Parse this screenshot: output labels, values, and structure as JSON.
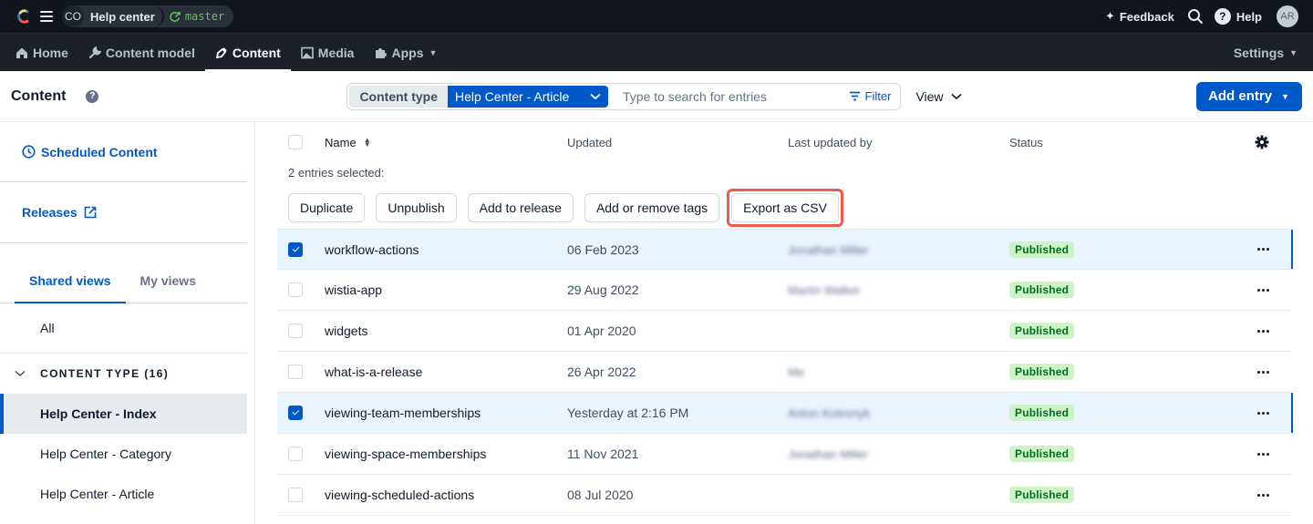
{
  "topbar": {
    "space_initials": "CO",
    "space_name": "Help center",
    "environment": "master",
    "feedback_label": "Feedback",
    "help_label": "Help",
    "avatar_initials": "AR"
  },
  "nav": {
    "items": [
      {
        "label": "Home",
        "icon": "home-icon",
        "active": false
      },
      {
        "label": "Content model",
        "icon": "wrench-icon",
        "active": false
      },
      {
        "label": "Content",
        "icon": "pen-icon",
        "active": true
      },
      {
        "label": "Media",
        "icon": "image-icon",
        "active": false
      },
      {
        "label": "Apps",
        "icon": "puzzle-icon",
        "active": false,
        "has_dropdown": true
      }
    ],
    "settings_label": "Settings"
  },
  "toolbar": {
    "title": "Content",
    "content_type_label": "Content type",
    "content_type_value": "Help Center - Article",
    "search_placeholder": "Type to search for entries",
    "search_value": "",
    "filter_label": "Filter",
    "view_label": "View",
    "add_entry_label": "Add entry"
  },
  "sidebar": {
    "scheduled_label": "Scheduled Content",
    "releases_label": "Releases",
    "tabs": [
      {
        "label": "Shared views",
        "active": true
      },
      {
        "label": "My views",
        "active": false
      }
    ],
    "all_label": "All",
    "content_type_header": "CONTENT TYPE (16)",
    "items": [
      {
        "label": "Help Center - Index",
        "active": true
      },
      {
        "label": "Help Center - Category",
        "active": false
      },
      {
        "label": "Help Center - Article",
        "active": false
      }
    ]
  },
  "table": {
    "columns": {
      "name": "Name",
      "updated": "Updated",
      "last_updated_by": "Last updated by",
      "status": "Status"
    },
    "bulk": {
      "selected_label": "2 entries selected:",
      "actions": [
        "Duplicate",
        "Unpublish",
        "Add to release",
        "Add or remove tags",
        "Export as CSV"
      ]
    },
    "rows": [
      {
        "name": "workflow-actions",
        "updated": "06 Feb 2023",
        "by": "Jonathan Miller",
        "status": "Published",
        "selected": true
      },
      {
        "name": "wistia-app",
        "updated": "29 Aug 2022",
        "by": "Martin Walker",
        "status": "Published",
        "selected": false
      },
      {
        "name": "widgets",
        "updated": "01 Apr 2020",
        "by": "",
        "status": "Published",
        "selected": false
      },
      {
        "name": "what-is-a-release",
        "updated": "26 Apr 2022",
        "by": "Me",
        "status": "Published",
        "selected": false
      },
      {
        "name": "viewing-team-memberships",
        "updated": "Yesterday at 2:16 PM",
        "by": "Anton Kolesnyk",
        "status": "Published",
        "selected": true
      },
      {
        "name": "viewing-space-memberships",
        "updated": "11 Nov 2021",
        "by": "Jonathan Miller",
        "status": "Published",
        "selected": false
      },
      {
        "name": "viewing-scheduled-actions",
        "updated": "08 Jul 2020",
        "by": "",
        "status": "Published",
        "selected": false
      }
    ]
  },
  "colors": {
    "primary": "#0059c8",
    "topbar_bg": "#11151c",
    "navbar_bg": "#1c2028",
    "published_bg": "#cdf3c6",
    "published_fg": "#006d23",
    "highlight": "#f05a4b",
    "selected_row": "#e8f5ff"
  }
}
